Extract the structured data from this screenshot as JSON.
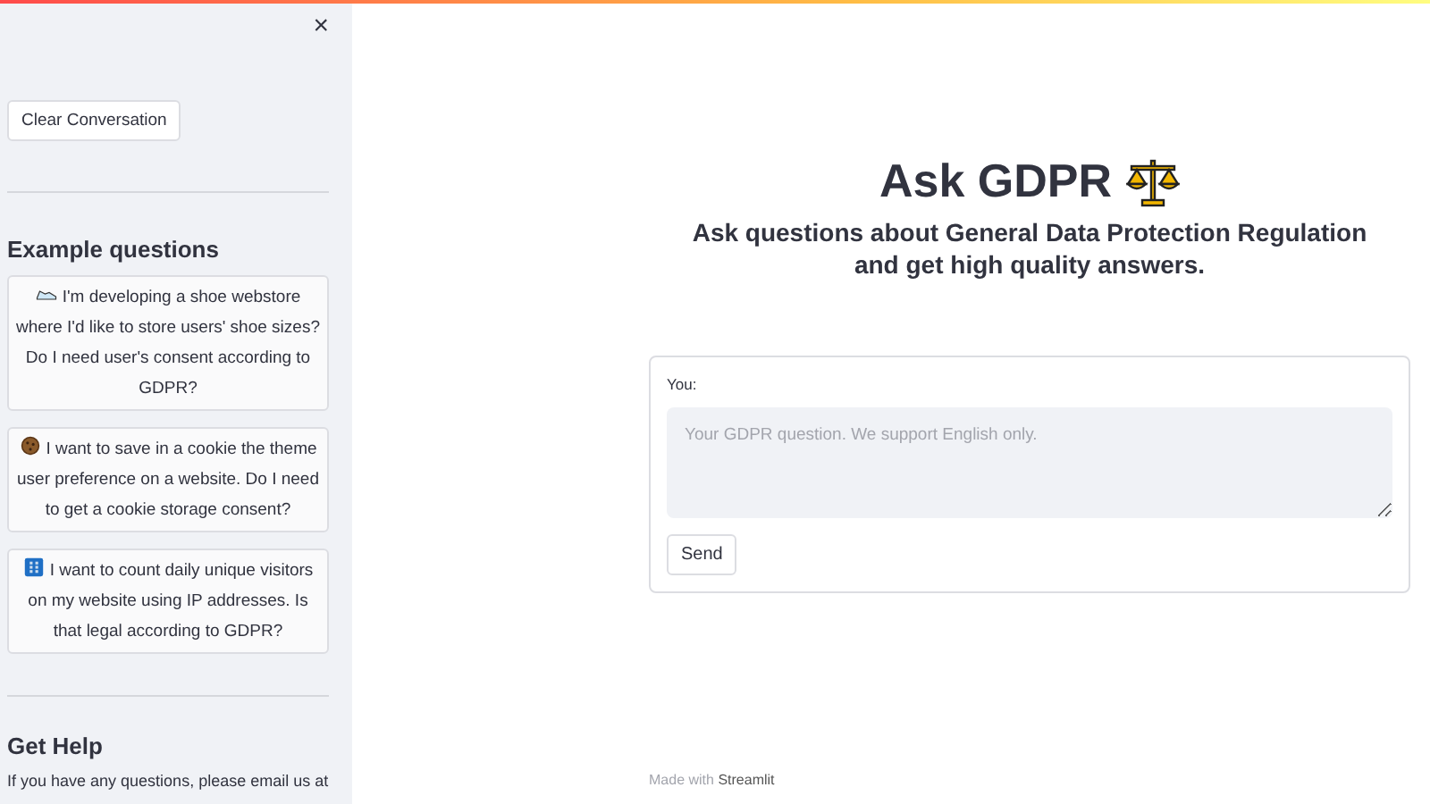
{
  "sidebar": {
    "close": "×",
    "clear_button": "Clear Conversation",
    "examples_heading": "Example questions",
    "examples": [
      {
        "kind": "shoe",
        "text": "I'm developing a shoe webstore where I'd like to store users' shoe sizes? Do I need user's consent according to GDPR?"
      },
      {
        "kind": "cookie",
        "text": "I want to save in a cookie the theme user preference on a website. Do I need to get a cookie storage consent?"
      },
      {
        "kind": "keypad",
        "text": "I want to count daily unique visitors on my website using IP addresses. Is that legal according to GDPR?"
      }
    ],
    "help_heading": "Get Help",
    "help_text": "If you have any questions, please email us at"
  },
  "main": {
    "title": "Ask GDPR",
    "subtitle": "Ask questions about General Data Protection Regulation and get high quality answers.",
    "form": {
      "label": "You:",
      "placeholder": "Your GDPR question. We support English only.",
      "button": "Send"
    },
    "footer": {
      "text": "Made with",
      "link": "Streamlit"
    }
  }
}
